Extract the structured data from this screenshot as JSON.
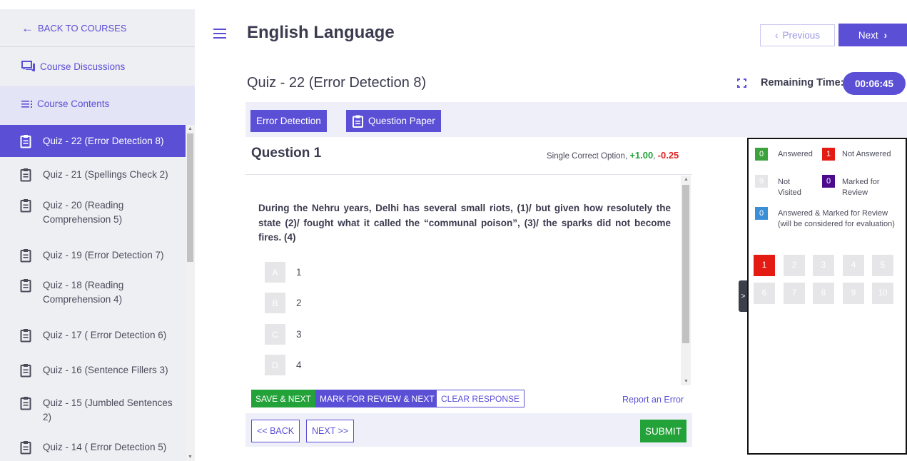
{
  "sidebar": {
    "back_label": "BACK TO COURSES",
    "discussions_label": "Course Discussions",
    "contents_label": "Course Contents",
    "items": [
      {
        "label": "Quiz - 22 (Error Detection 8)",
        "active": true
      },
      {
        "label": "Quiz - 21 (Spellings Check 2)",
        "active": false
      },
      {
        "label": "Quiz - 20 (Reading Comprehension 5)",
        "active": false
      },
      {
        "label": "Quiz - 19 (Error Detection 7)",
        "active": false
      },
      {
        "label": "Quiz - 18 (Reading Comprehension 4)",
        "active": false
      },
      {
        "label": "Quiz - 17 ( Error Detection 6)",
        "active": false
      },
      {
        "label": "Quiz - 16 (Sentence Fillers 3)",
        "active": false
      },
      {
        "label": "Quiz - 15 (Jumbled Sentences 2)",
        "active": false
      },
      {
        "label": "Quiz - 14 ( Error Detection 5)",
        "active": false
      }
    ]
  },
  "header": {
    "title": "English Language",
    "prev_label": "Previous",
    "next_label": "Next",
    "quiz_title": "Quiz - 22 (Error Detection 8)",
    "remaining_label": "Remaining Time:",
    "remaining_time": "00:06:45"
  },
  "sections": {
    "tab_label": "Error Detection",
    "paper_label": "Question Paper"
  },
  "question": {
    "heading": "Question 1",
    "marks_prefix": "Single Correct Option,",
    "positive": "+1.00",
    "negative": "-0.25",
    "text": "During the Nehru years, Delhi has several small riots, (1)/ but given how resolutely the state (2)/ fought what it called the “communal poison”, (3)/ the sparks did not become fires. (4)",
    "options": [
      {
        "letter": "A",
        "text": "1"
      },
      {
        "letter": "B",
        "text": "2"
      },
      {
        "letter": "C",
        "text": "3"
      },
      {
        "letter": "D",
        "text": "4"
      }
    ]
  },
  "actions": {
    "save_next": "SAVE & NEXT",
    "mark_review_next": "MARK FOR REVIEW & NEXT",
    "clear_response": "CLEAR RESPONSE",
    "report_error": "Report an Error",
    "back": "<< BACK",
    "next": "NEXT >>",
    "submit": "SUBMIT"
  },
  "palette": {
    "toggle": ">",
    "legend": {
      "answered": {
        "count": "0",
        "label": "Answered",
        "color": "#3ca33c"
      },
      "not_answered": {
        "count": "1",
        "label": "Not Answered",
        "color": "#e41b13"
      },
      "not_visited": {
        "count": "9",
        "label_1": "Not",
        "label_2": "Visited",
        "color": "#e6e6e8"
      },
      "marked_review": {
        "count": "0",
        "label_1": "Marked for",
        "label_2": "Review",
        "color": "#4b0b8c"
      },
      "answered_marked": {
        "count": "0",
        "label_1": "Answered & Marked for Review",
        "label_2": "(will be considered for evaluation)",
        "color": "#3a8fd6"
      }
    },
    "questions": [
      "1",
      "2",
      "3",
      "4",
      "5",
      "6",
      "7",
      "8",
      "9",
      "10"
    ],
    "current_question": "1"
  },
  "colors": {
    "accent": "#5b4fd6",
    "success": "#23a23a",
    "danger": "#e41b13"
  }
}
